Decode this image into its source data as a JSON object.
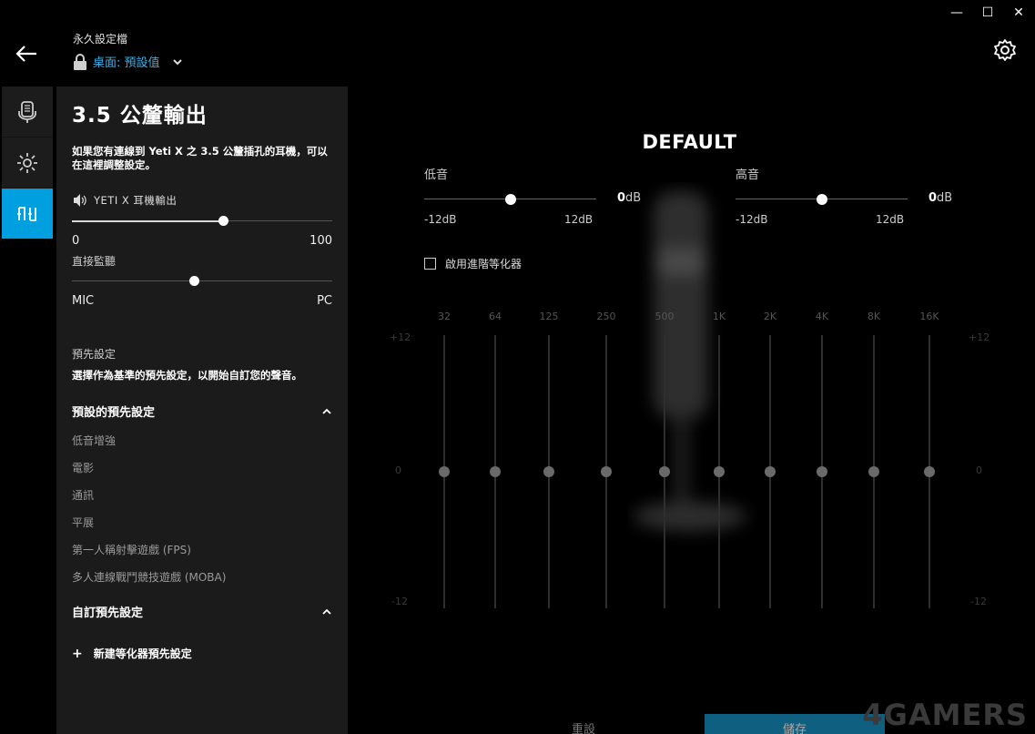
{
  "window": {
    "controls": [
      {
        "name": "minimize",
        "glyph": "—"
      },
      {
        "name": "maximize",
        "glyph": "☐"
      },
      {
        "name": "close",
        "glyph": "✕"
      }
    ]
  },
  "header": {
    "profile_caption": "永久設定檔",
    "profile_value": "桌面: 預設值",
    "accent_color": "#3ab0e8"
  },
  "rail": {
    "tabs": [
      {
        "icon": "microphone-icon",
        "active": false
      },
      {
        "icon": "brightness-icon",
        "active": false
      },
      {
        "icon": "headphone-output-icon",
        "active": true
      }
    ],
    "active_color": "#00a0e0"
  },
  "panel": {
    "title": "3.5 公釐輸出",
    "description": "如果您有連線到 Yeti X 之 3.5 公釐插孔的耳機，可以在這裡調整設定。",
    "volume": {
      "label": "YETI X 耳機輸出",
      "min": "0",
      "max": "100",
      "value": 58
    },
    "monitor": {
      "label": "直接監聽",
      "min": "MIC",
      "max": "PC",
      "value": 47
    },
    "presets": {
      "label": "預先設定",
      "hint": "選擇作為基準的預先設定，以開始自訂您的聲音。",
      "default_group": {
        "title": "預設的預先設定",
        "items": [
          "低音增強",
          "電影",
          "通訊",
          "平展",
          "第一人稱射擊遊戲 (FPS)",
          "多人連線戰鬥競技遊戲 (MOBA)"
        ]
      },
      "custom_group": {
        "title": "自訂預先設定"
      },
      "new_preset": "新建等化器預先設定"
    }
  },
  "main": {
    "title": "DEFAULT",
    "bass": {
      "label": "低音",
      "value": "0",
      "unit": "dB",
      "min": "-12dB",
      "max": "12dB",
      "level": 0
    },
    "treble": {
      "label": "高音",
      "value": "0",
      "unit": "dB",
      "min": "-12dB",
      "max": "12dB",
      "level": 0
    },
    "advanced_eq_label": "啟用進階等化器",
    "eq": {
      "bands": [
        {
          "freq": "32",
          "gain": 0
        },
        {
          "freq": "64",
          "gain": 0
        },
        {
          "freq": "125",
          "gain": 0
        },
        {
          "freq": "250",
          "gain": 0
        },
        {
          "freq": "500",
          "gain": 0
        },
        {
          "freq": "1K",
          "gain": 0
        },
        {
          "freq": "2K",
          "gain": 0
        },
        {
          "freq": "4K",
          "gain": 0
        },
        {
          "freq": "8K",
          "gain": 0
        },
        {
          "freq": "16K",
          "gain": 0
        }
      ],
      "axis_top": "+12",
      "axis_mid": "0",
      "axis_bottom": "-12",
      "range": [
        -12,
        12
      ]
    },
    "reset_label": "重設",
    "save_label": "儲存"
  },
  "watermark": "4GAMERS"
}
